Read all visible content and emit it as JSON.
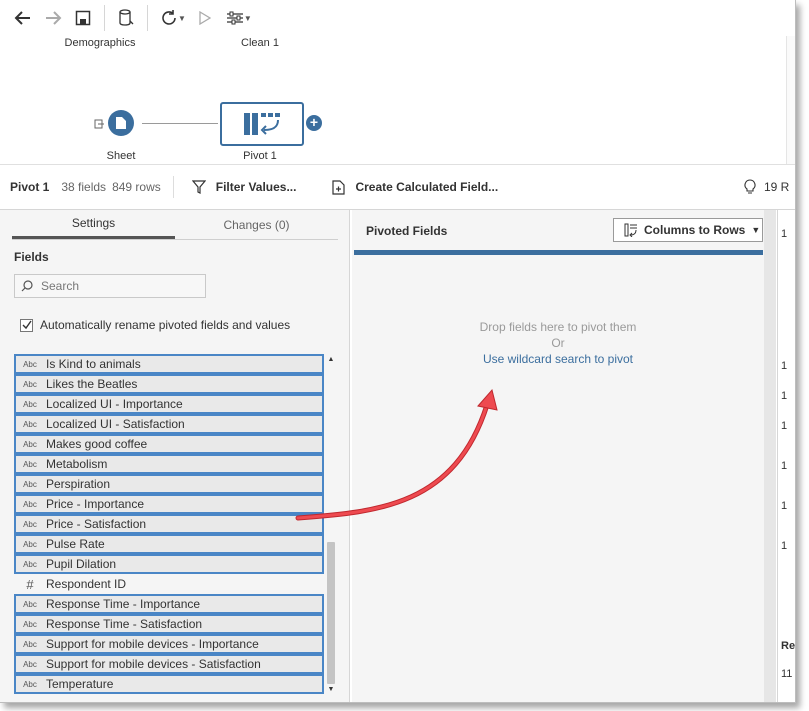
{
  "toolbar": {
    "icons": [
      "back-arrow-icon",
      "forward-arrow-icon",
      "save-icon",
      "data-source-icon",
      "refresh-icon",
      "run-icon",
      "settings-sliders-icon"
    ]
  },
  "canvas": {
    "node_top_labels": [
      "Demographics",
      "Clean 1"
    ],
    "sheet_label": "Sheet",
    "pivot_label": "Pivot 1"
  },
  "header": {
    "name": "Pivot 1",
    "fields": "38 fields",
    "rows": "849 rows",
    "filter_label": "Filter Values...",
    "calc_label": "Create Calculated Field...",
    "reco_label": "19 R"
  },
  "settings": {
    "tab_settings": "Settings",
    "tab_changes": "Changes (0)",
    "fields_title": "Fields",
    "search_placeholder": "Search",
    "auto_rename_label": "Automatically rename pivoted fields and values",
    "auto_rename_checked": true,
    "fields": [
      {
        "type": "Abc",
        "name": "Is Kind to animals",
        "selected": true
      },
      {
        "type": "Abc",
        "name": "Likes the Beatles",
        "selected": true
      },
      {
        "type": "Abc",
        "name": "Localized UI - Importance",
        "selected": true
      },
      {
        "type": "Abc",
        "name": "Localized UI - Satisfaction",
        "selected": true
      },
      {
        "type": "Abc",
        "name": "Makes good coffee",
        "selected": true
      },
      {
        "type": "Abc",
        "name": "Metabolism",
        "selected": true
      },
      {
        "type": "Abc",
        "name": "Perspiration",
        "selected": true
      },
      {
        "type": "Abc",
        "name": "Price - Importance",
        "selected": true
      },
      {
        "type": "Abc",
        "name": "Price - Satisfaction",
        "selected": true
      },
      {
        "type": "Abc",
        "name": "Pulse Rate",
        "selected": true
      },
      {
        "type": "Abc",
        "name": "Pupil Dilation",
        "selected": true
      },
      {
        "type": "#",
        "name": "Respondent ID",
        "selected": false
      },
      {
        "type": "Abc",
        "name": "Response Time - Importance",
        "selected": true
      },
      {
        "type": "Abc",
        "name": "Response Time - Satisfaction",
        "selected": true
      },
      {
        "type": "Abc",
        "name": "Support for mobile devices - Importance",
        "selected": true
      },
      {
        "type": "Abc",
        "name": "Support for mobile devices - Satisfaction",
        "selected": true
      },
      {
        "type": "Abc",
        "name": "Temperature",
        "selected": true
      }
    ]
  },
  "pivot": {
    "title": "Pivoted Fields",
    "mode_label": "Columns to Rows",
    "drop_hint": "Drop fields here to pivot them",
    "or_text": "Or",
    "wildcard_link": "Use wildcard search to pivot"
  },
  "right_panel": {
    "text_1": "1",
    "text_2": "1",
    "text_3": "1",
    "text_4": "1",
    "text_5": "1",
    "text_6": "1",
    "text_7": "1",
    "bottom_label": "Re",
    "bottom_value": "11"
  },
  "colors": {
    "accent": "#3b6e9e",
    "selection_border": "#4a86c6",
    "arrow": "#e8393f"
  }
}
